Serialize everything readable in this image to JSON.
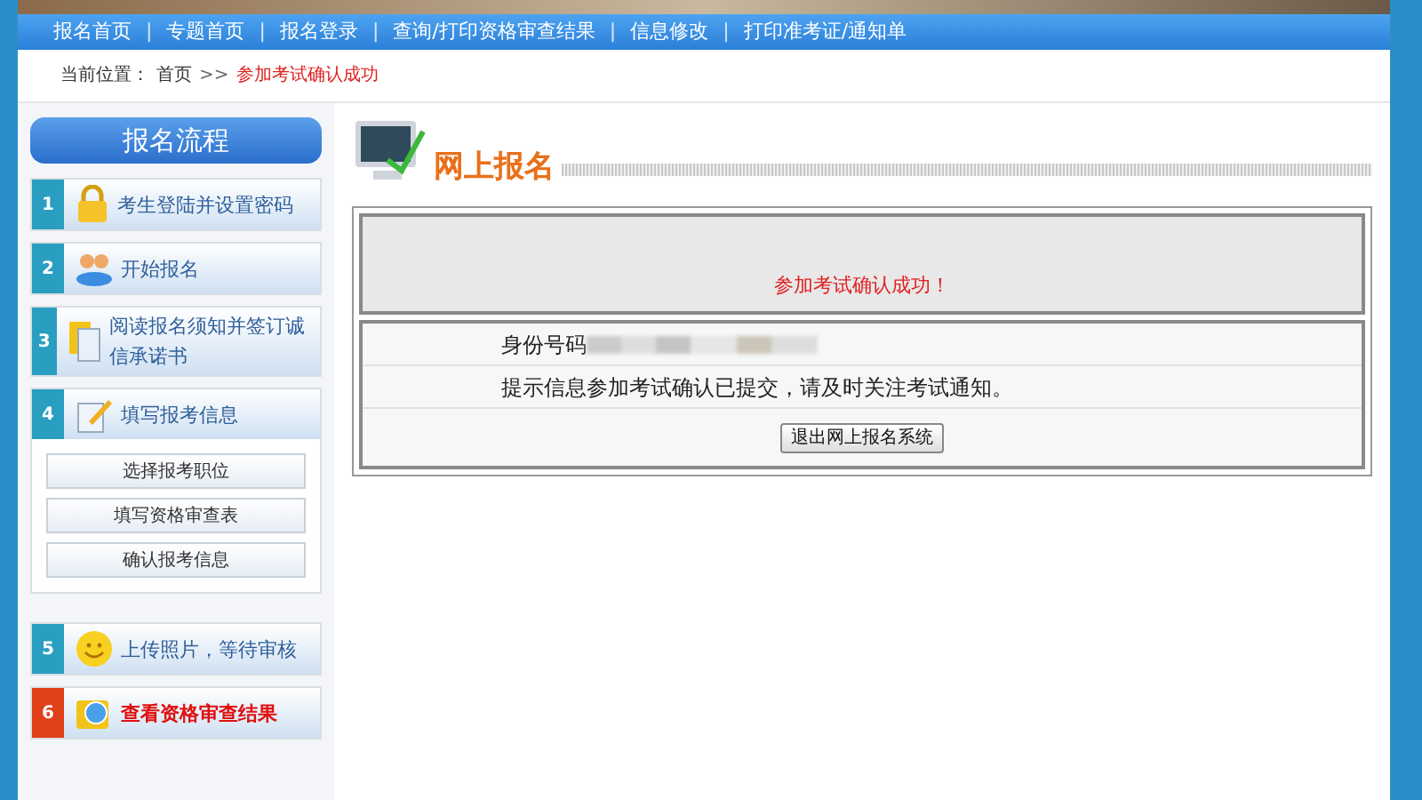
{
  "nav": [
    "报名首页",
    "专题首页",
    "报名登录",
    "查询/打印资格审查结果",
    "信息修改",
    "打印准考证/通知单"
  ],
  "nav_separator": "|",
  "breadcrumb": {
    "label": "当前位置：",
    "home": "首页",
    "arrow": ">>",
    "current": "参加考试确认成功"
  },
  "sidebar": {
    "title": "报名流程",
    "steps": [
      {
        "number": "1",
        "label": "考生登陆并设置密码",
        "highlighted": false
      },
      {
        "number": "2",
        "label": "开始报名",
        "highlighted": false
      },
      {
        "number": "3",
        "label": "阅读报名须知并签订诚信承诺书",
        "highlighted": false
      },
      {
        "number": "4",
        "label": "填写报考信息",
        "highlighted": false,
        "children": [
          "选择报考职位",
          "填写资格审查表",
          "确认报考信息"
        ]
      },
      {
        "number": "5",
        "label": "上传照片，等待审核",
        "highlighted": false
      },
      {
        "number": "6",
        "label": "查看资格审查结果",
        "highlighted": true
      }
    ]
  },
  "main": {
    "heading": "网上报名",
    "message": "参加考试确认成功！",
    "rows": [
      {
        "label": "身份号码",
        "redacted": true
      },
      {
        "label": "提示信息",
        "value": "参加考试确认已提交，请及时关注考试通知。",
        "redacted": false
      }
    ],
    "button": "退出网上报名系统"
  }
}
